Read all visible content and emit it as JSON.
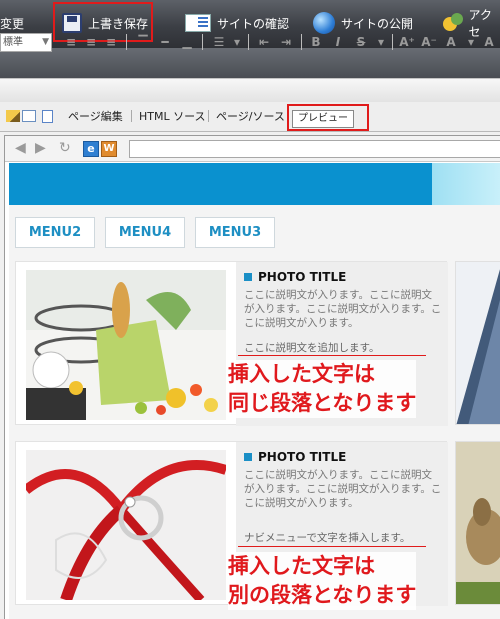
{
  "toolbar": {
    "cut_label": "変更",
    "save_label": "上書き保存",
    "site_check_label": "サイトの確認",
    "site_publish_label": "サイトの公開",
    "access_label": "アクセ"
  },
  "format": {
    "style_value": "標準",
    "bold": "B",
    "italic": "I",
    "strike": "S"
  },
  "tabs": {
    "page_edit": "ページ編集",
    "html_source": "HTML ソース",
    "page_source": "ページ/ソース",
    "preview": "プレビュー"
  },
  "preview": {
    "menu": [
      "MENU2",
      "MENU4",
      "MENU3"
    ],
    "cards": [
      {
        "title": "PHOTO TITLE",
        "description": "ここに説明文が入ります。ここに説明文が入ります。ここに説明文が入ります。ここに説明文が入ります。",
        "extra": "ここに説明文を追加します。",
        "annotation_line1": "挿入した文字は",
        "annotation_line2": "同じ段落となります"
      },
      {
        "title": "PHOTO TITLE",
        "description": "ここに説明文が入ります。ここに説明文が入ります。ここに説明文が入ります。ここに説明文が入ります。",
        "extra": "ナビメニューで文字を挿入します。",
        "annotation_line1": "挿入した文字は",
        "annotation_line2": "別の段落となります"
      }
    ]
  },
  "colors": {
    "highlight": "#e01b1b",
    "brand_blue": "#0a91cf",
    "annotation_red": "#e0191d"
  }
}
